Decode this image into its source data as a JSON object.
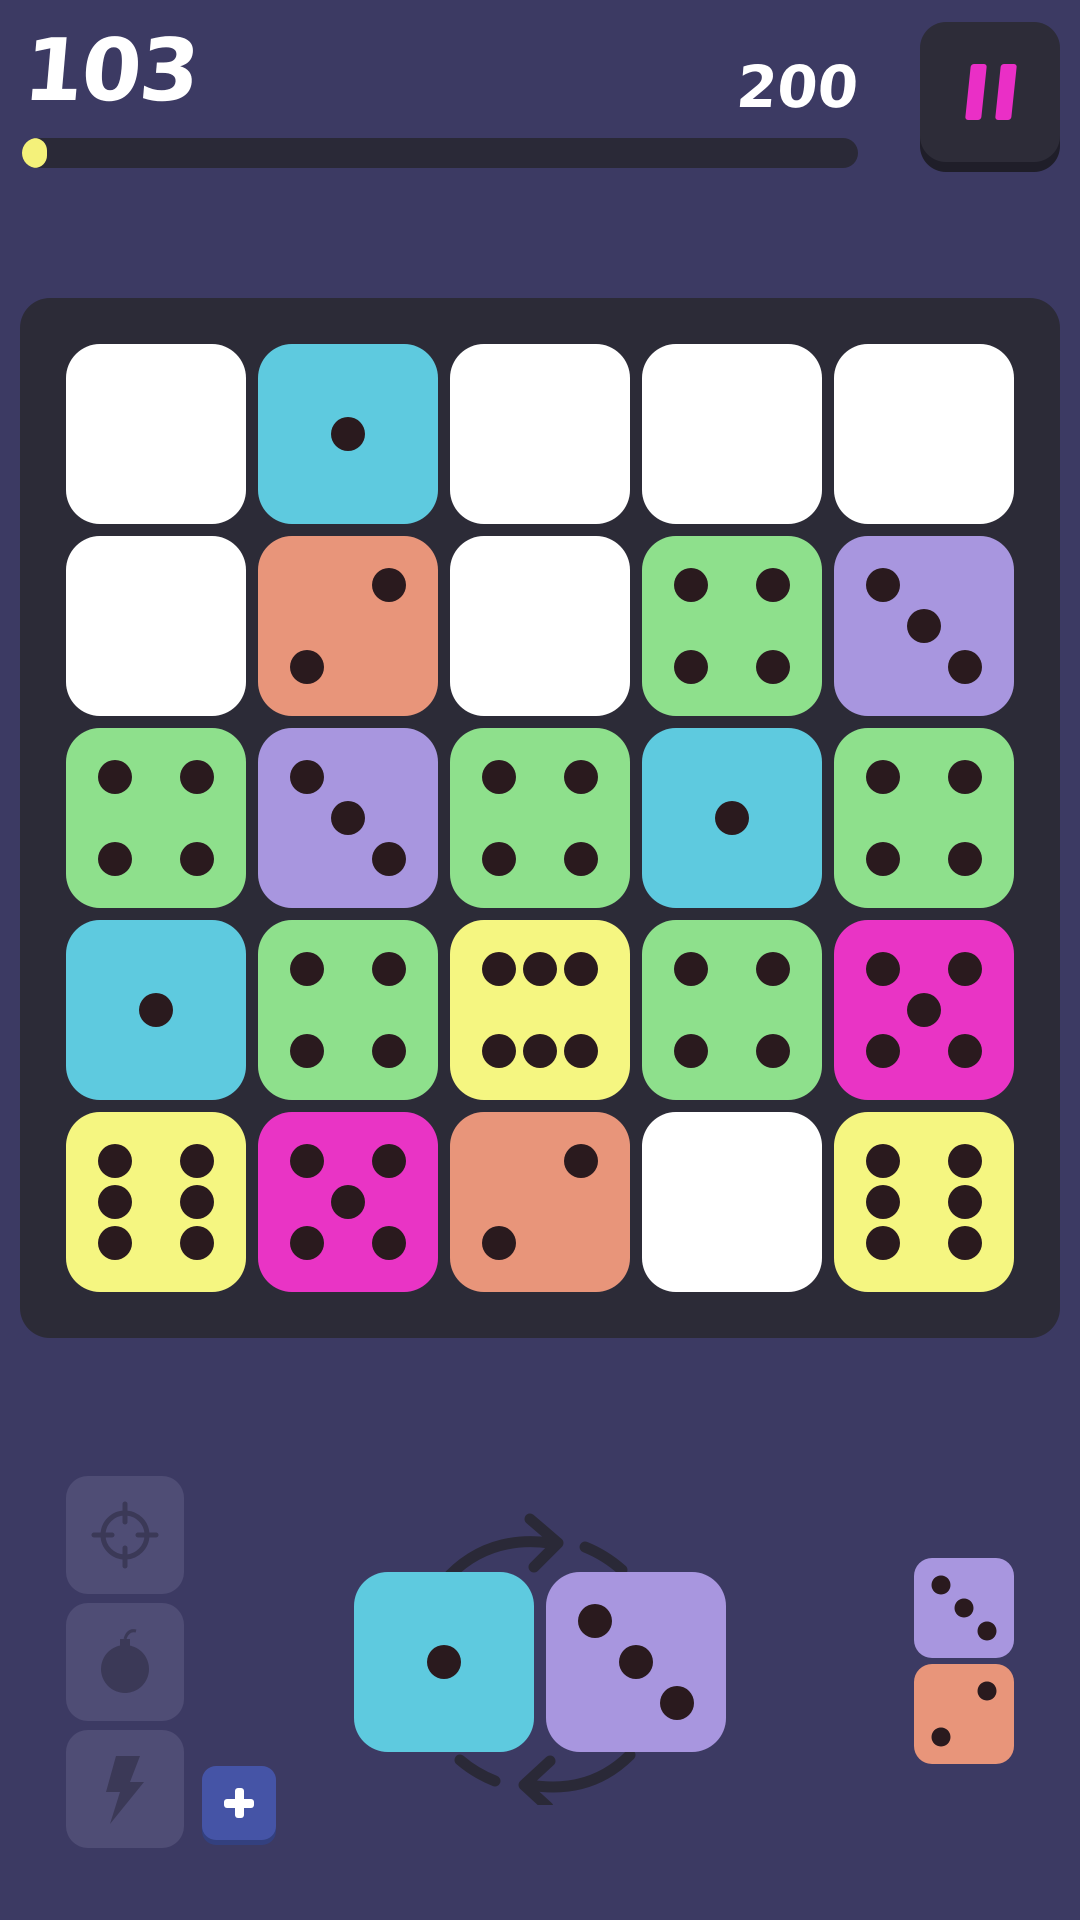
{
  "hud": {
    "score": "103",
    "target": "200",
    "progress": 0.03
  },
  "colors": {
    "background": "#3c3a63",
    "board": "#2c2b37",
    "empty": "#ffffff",
    "die_colors": {
      "1": "#5ecadf",
      "2": "#e8957a",
      "3": "#a896df",
      "4": "#8ee08c",
      "5": "#e934c5",
      "6": "#f5f681"
    },
    "pip_color": "#2a1a1e",
    "pause_icon": "#ea2fc6",
    "progress_fill": "#f4f17a"
  },
  "board": [
    [
      0,
      1,
      0,
      0,
      0
    ],
    [
      0,
      2,
      0,
      4,
      3
    ],
    [
      4,
      3,
      4,
      1,
      4
    ],
    [
      1,
      4,
      6,
      4,
      5
    ],
    [
      6,
      5,
      2,
      0,
      6
    ]
  ],
  "current_piece": [
    1,
    3
  ],
  "next_piece": [
    3,
    2
  ],
  "tools": [
    {
      "name": "target-icon"
    },
    {
      "name": "bomb-icon"
    },
    {
      "name": "lightning-icon"
    }
  ],
  "controls": {
    "pause_icon": "pause-icon",
    "add_icon": "plus-icon",
    "rotate_icon": "rotate-arrows-icon"
  }
}
